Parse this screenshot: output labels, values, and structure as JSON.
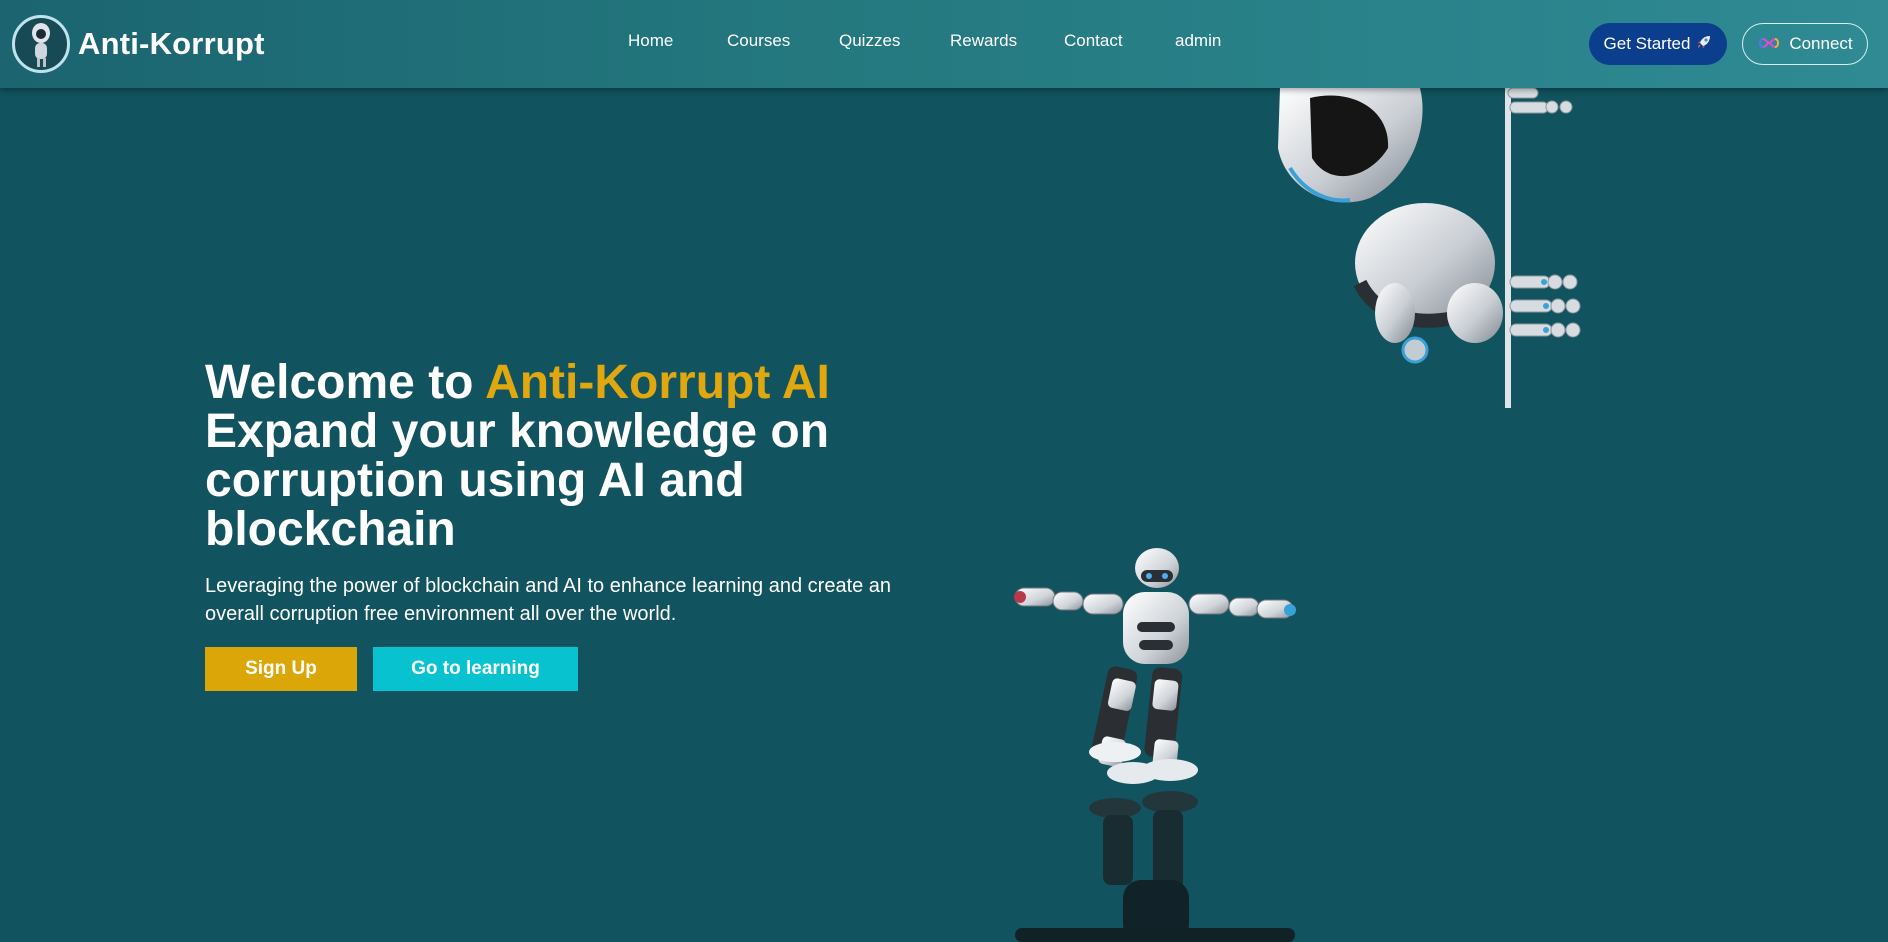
{
  "brand": {
    "name": "Anti-Korrupt",
    "logo_icon": "robot-logo-icon"
  },
  "nav": {
    "items": [
      {
        "label": "Home"
      },
      {
        "label": "Courses"
      },
      {
        "label": "Quizzes"
      },
      {
        "label": "Rewards"
      },
      {
        "label": "Contact"
      },
      {
        "label": "admin"
      }
    ]
  },
  "actions": {
    "get_started_label": "Get Started",
    "get_started_icon": "rocket-icon",
    "connect_label": "Connect",
    "connect_icon": "infinity-wallet-icon"
  },
  "hero": {
    "title_prefix": "Welcome to ",
    "title_accent": "Anti-Korrupt AI",
    "title_rest": "Expand your knowledge on corruption using AI and blockchain",
    "description": "Leveraging the power of blockchain and AI to enhance learning and create an overall corruption free environment all over the world.",
    "signup_label": "Sign Up",
    "learning_label": "Go to learning"
  },
  "colors": {
    "background": "#11535e",
    "navbar": "#24797f",
    "accent": "#e0a80e",
    "signup_button": "#dba608",
    "learning_button": "#08c3cf",
    "get_started_button": "#0b3e8c"
  }
}
